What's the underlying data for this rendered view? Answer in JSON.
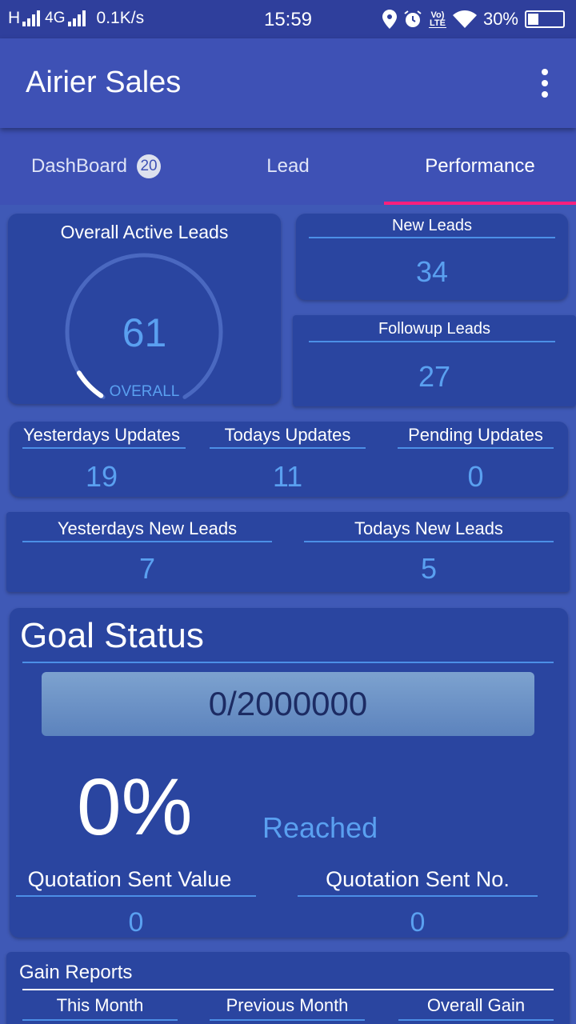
{
  "status_bar": {
    "network": "H",
    "net2": "4G",
    "speed": "0.1K/s",
    "time": "15:59",
    "volte": "Vo LTE",
    "battery": "30%"
  },
  "appbar": {
    "title": "Airier Sales"
  },
  "tabs": [
    {
      "label": "DashBoard",
      "badge": "20"
    },
    {
      "label": "Lead"
    },
    {
      "label": "Performance",
      "active": true
    }
  ],
  "overall": {
    "title": "Overall Active Leads",
    "value": "61",
    "caption": "OVERALL",
    "progress_fraction": 0.08
  },
  "new_leads": {
    "title": "New Leads",
    "value": "34"
  },
  "followup_leads": {
    "title": "Followup Leads",
    "value": "27"
  },
  "updates": [
    {
      "title": "Yesterdays Updates",
      "value": "19"
    },
    {
      "title": "Todays Updates",
      "value": "11"
    },
    {
      "title": "Pending Updates",
      "value": "0"
    }
  ],
  "new_leads_row": [
    {
      "title": "Yesterdays New Leads",
      "value": "7"
    },
    {
      "title": "Todays New Leads",
      "value": "5"
    }
  ],
  "goal": {
    "title": "Goal Status",
    "progress_text": "0/2000000",
    "percent": "0%",
    "reached_label": "Reached",
    "quotation_value_label": "Quotation Sent Value",
    "quotation_value": "0",
    "quotation_no_label": "Quotation Sent No.",
    "quotation_no": "0"
  },
  "gain": {
    "title": "Gain Reports",
    "columns": [
      "This Month",
      "Previous Month",
      "Overall Gain"
    ]
  },
  "colors": {
    "accent": "#ff1f7c",
    "value_blue": "#5aa0f0",
    "card": "#2a45a0",
    "background": "#3f59b6"
  }
}
